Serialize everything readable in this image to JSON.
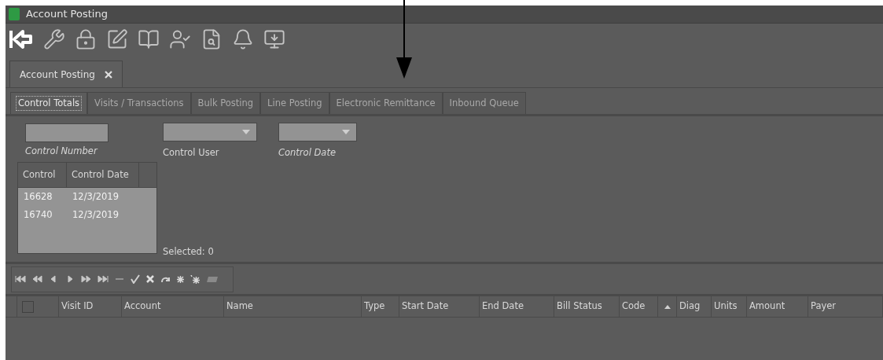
{
  "window": {
    "title": "Account Posting"
  },
  "doc_tabs": [
    {
      "label": "Account Posting",
      "selected": true
    }
  ],
  "tabs": [
    {
      "label": "Control Totals",
      "selected": true
    },
    {
      "label": "Visits / Transactions",
      "selected": false
    },
    {
      "label": "Bulk Posting",
      "selected": false
    },
    {
      "label": "Line Posting",
      "selected": false
    },
    {
      "label": "Electronic Remittance",
      "selected": false
    },
    {
      "label": "Inbound Queue",
      "selected": false
    }
  ],
  "filters": [
    {
      "kind": "text",
      "label": "Control Number",
      "italic": true
    },
    {
      "kind": "dropdown",
      "label": "Control User",
      "italic": false
    },
    {
      "kind": "dropdown",
      "label": "Control Date",
      "italic": true
    }
  ],
  "controls_table": {
    "columns": [
      "Control",
      "Control Date"
    ],
    "rows": [
      [
        "16628",
        "12/3/2019"
      ],
      [
        "16740",
        "12/3/2019"
      ]
    ]
  },
  "selected_count": "Selected: 0",
  "grid": {
    "select_all": {
      "checked": false
    },
    "columns": [
      "Visit ID",
      "Account",
      "Name",
      "Type",
      "Start Date",
      "End Date",
      "Bill Status",
      "Code",
      "Diag",
      "Units",
      "Amount",
      "Payer"
    ]
  }
}
